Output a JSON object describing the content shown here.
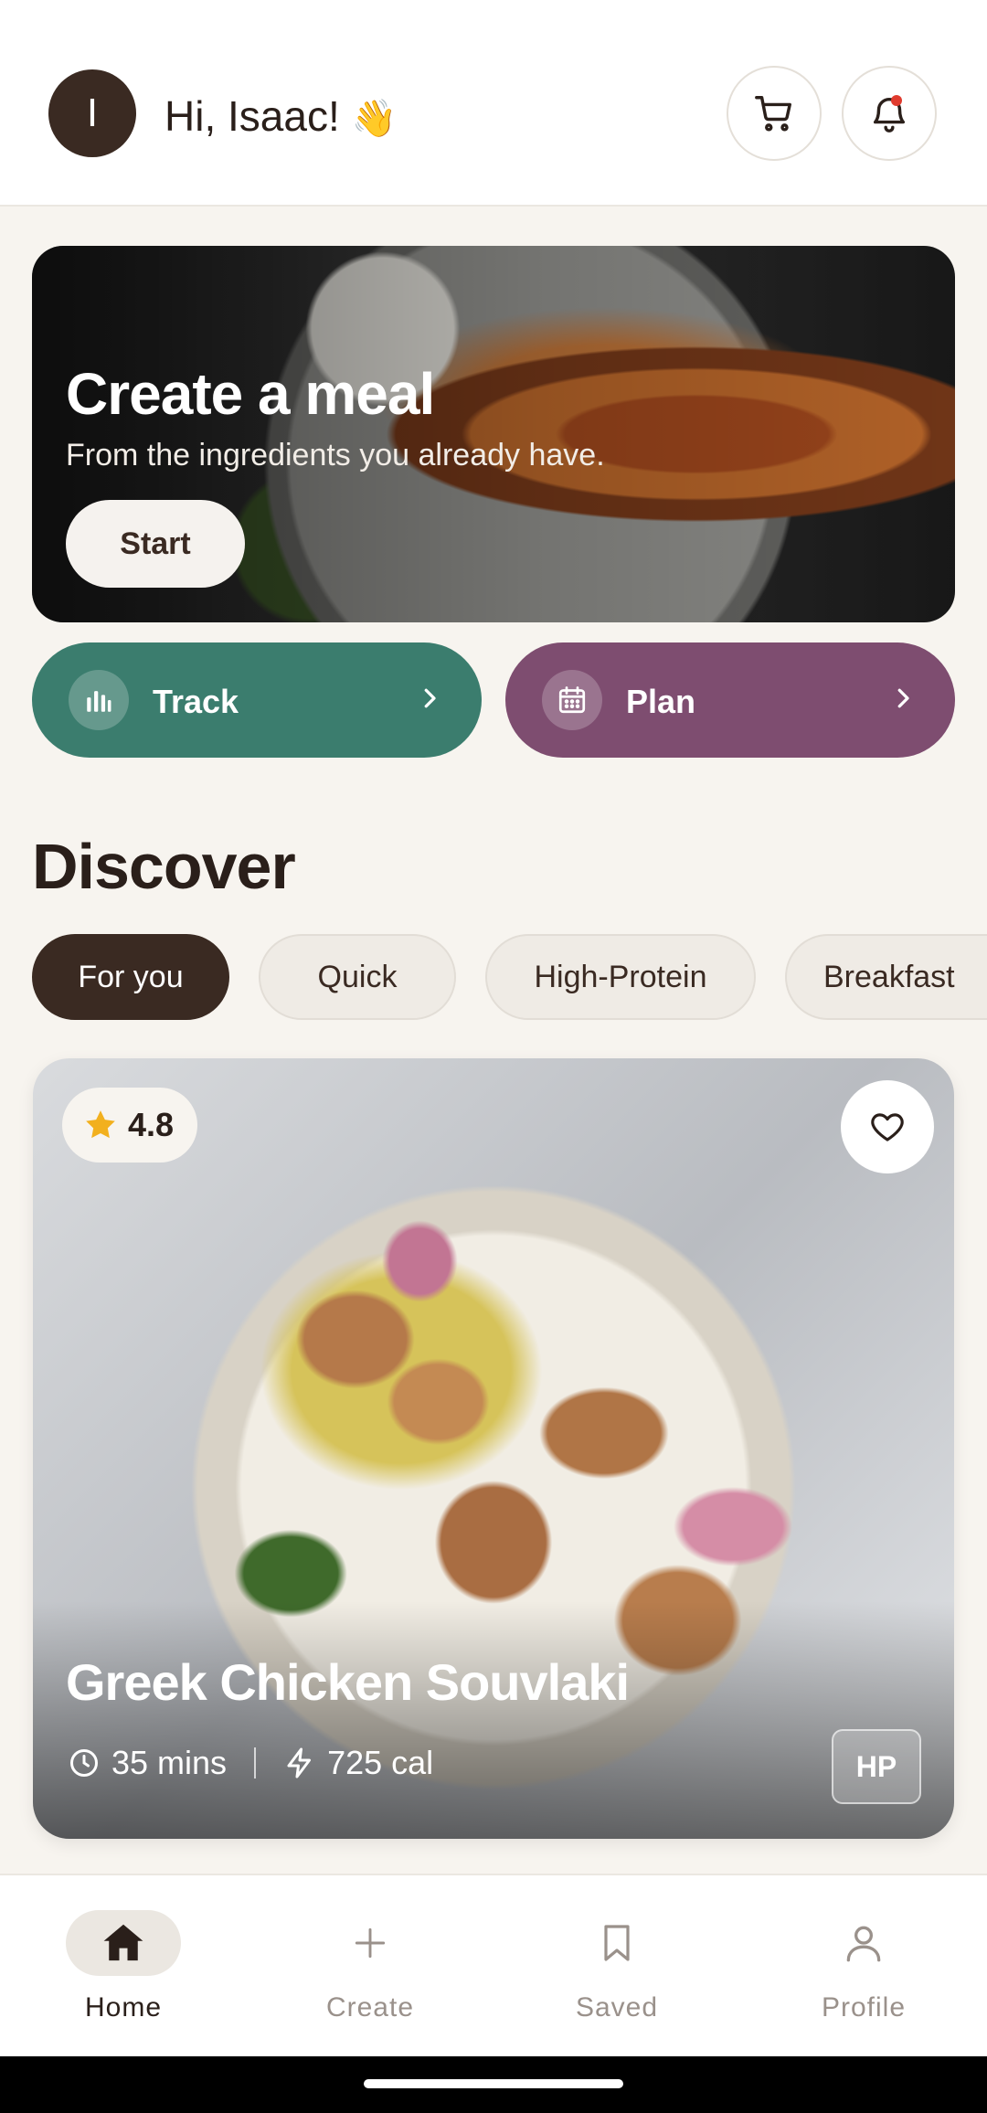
{
  "header": {
    "avatar_initial": "I",
    "greeting": "Hi, Isaac!",
    "wave_emoji": "👋",
    "cart_icon": "cart-icon",
    "bell_icon": "bell-icon"
  },
  "hero": {
    "title": "Create a meal",
    "subtitle": "From the ingredients you already have.",
    "button_label": "Start"
  },
  "actions": {
    "track": {
      "label": "Track",
      "color": "#3b7d6e",
      "icon": "bar-chart-icon"
    },
    "plan": {
      "label": "Plan",
      "color": "#7e4d70",
      "icon": "calendar-icon"
    }
  },
  "discover": {
    "title": "Discover",
    "chips": [
      "For you",
      "Quick",
      "High-Protein",
      "Breakfast"
    ],
    "active_chip": "For you"
  },
  "recipe": {
    "rating": "4.8",
    "title": "Greek Chicken Souvlaki",
    "time": "35 mins",
    "calories": "725 cal",
    "badge": "HP"
  },
  "nav": {
    "items": [
      {
        "label": "Home",
        "icon": "home-icon",
        "active": true
      },
      {
        "label": "Create",
        "icon": "plus-icon",
        "active": false
      },
      {
        "label": "Saved",
        "icon": "bookmark-icon",
        "active": false
      },
      {
        "label": "Profile",
        "icon": "person-icon",
        "active": false
      }
    ]
  },
  "colors": {
    "brand_dark": "#3a2a22",
    "background": "#f7f4ef",
    "notification": "#e03b2e"
  }
}
